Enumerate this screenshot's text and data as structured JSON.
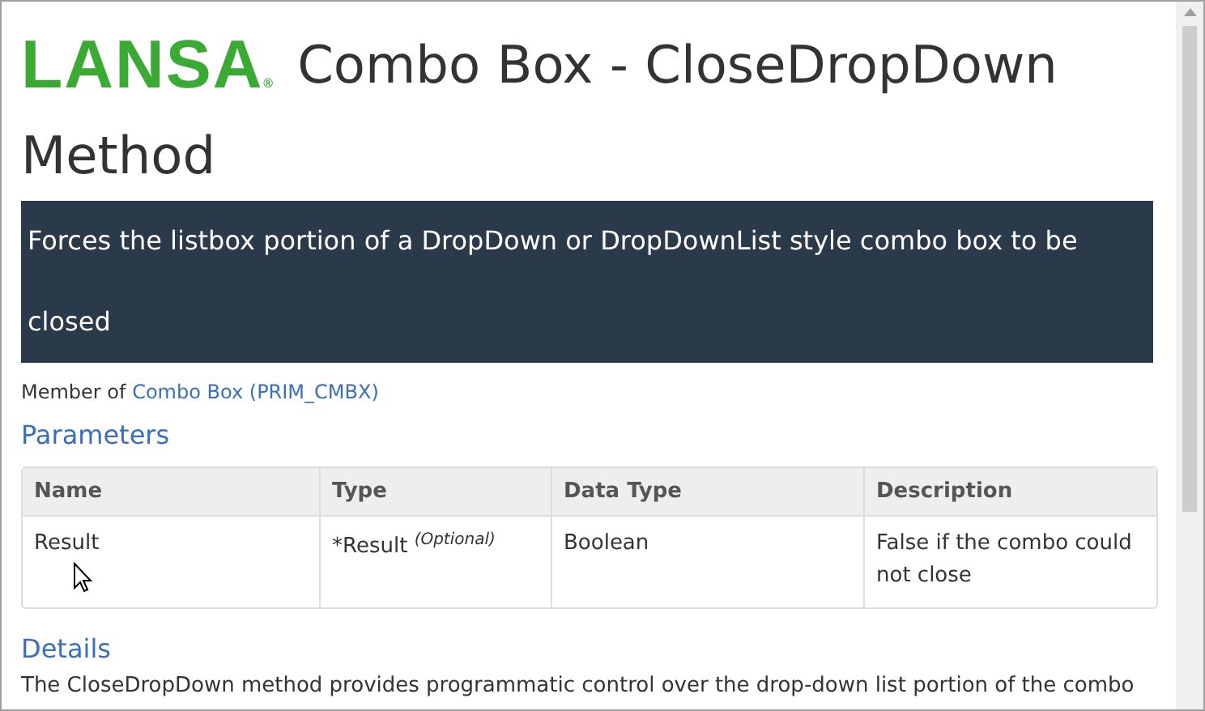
{
  "logo": {
    "text": "LANSA",
    "mark": "®"
  },
  "title": "Combo Box - CloseDropDown Method",
  "summary": "Forces the listbox portion of a DropDown or DropDownList style combo box to be closed",
  "member_of": {
    "label": "Member of",
    "link": "Combo Box (PRIM_CMBX)"
  },
  "parameters": {
    "heading": "Parameters",
    "columns": [
      "Name",
      "Type",
      "Data Type",
      "Description"
    ],
    "rows": [
      [
        "Result",
        "*Result $^{(Optional)}$",
        "Boolean",
        "False if the combo could not close"
      ]
    ]
  },
  "details": {
    "heading": "Details",
    "text": "The CloseDropDown method provides programmatic control over the drop-down list portion of the combo"
  }
}
